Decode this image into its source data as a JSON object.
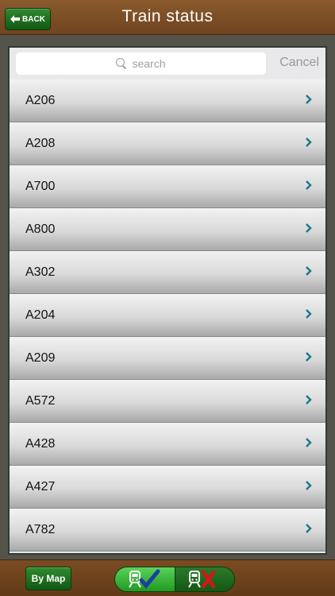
{
  "header": {
    "back_label": "BACK",
    "title": "Train status"
  },
  "search": {
    "placeholder": "search",
    "cancel_label": "Cancel"
  },
  "trains": [
    "A206",
    "A208",
    "A700",
    "A800",
    "A302",
    "A204",
    "A209",
    "A572",
    "A428",
    "A427",
    "A782"
  ],
  "footer": {
    "by_map_label": "By Map",
    "segments": [
      {
        "name": "running-trains",
        "icon": "train-check-icon",
        "selected": true
      },
      {
        "name": "cancelled-trains",
        "icon": "train-x-icon",
        "selected": false
      }
    ]
  },
  "colors": {
    "header_brown": "#7a4c22",
    "button_green": "#1f7a1f",
    "chevron_teal": "#1f7a8a",
    "check_blue": "#1c3f9e",
    "cross_red": "#d01818"
  }
}
